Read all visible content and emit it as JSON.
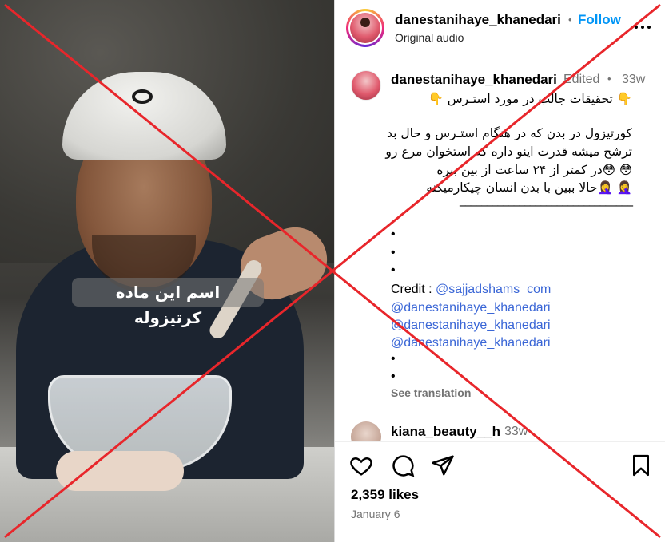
{
  "video": {
    "caption_text": "اسم این ماده کرتیزوله"
  },
  "header": {
    "username": "danestanihaye_khanedari",
    "dot": "•",
    "follow_label": "Follow",
    "audio": "Original audio",
    "more_icon": "more-horizontal-icon"
  },
  "caption": {
    "username": "danestanihaye_khanedari",
    "edited": "Edited",
    "dot": "•",
    "time": "33w",
    "lines": [
      "👇 تحقیقات جالب در مورد استـرس 👇",
      "کورتیزول در بدن که در هنگام استـرس و حال بد",
      "ترشح میشه قدرت اینو داره که استخوان مرغ رو",
      "😳 😳در کمتر از ۲۴ ساعت از بین ببره",
      "🤦‍♀️ 🤦‍♀️حالا ببین با بدن انسان چیکارمیکنه",
      "________________________________"
    ],
    "bullets": [
      "•",
      "•",
      "•",
      "•",
      "•"
    ],
    "credit_label": "Credit :",
    "credit_handle": "@sajjadshams_com",
    "mentions": [
      "@danestanihaye_khanedari",
      "@danestanihaye_khanedari",
      "@danestanihaye_khanedari"
    ],
    "see_translation": "See translation"
  },
  "comment": {
    "username": "kiana_beauty__h",
    "time": "33w"
  },
  "actions": {
    "icons": [
      "heart-icon",
      "comment-icon",
      "share-icon",
      "bookmark-icon"
    ],
    "likes": "2,359 likes",
    "date": "January 6"
  },
  "colors": {
    "follow": "#0095f6",
    "link": "#3a66d6",
    "x_overlay": "#e8262b",
    "muted": "#737373"
  }
}
